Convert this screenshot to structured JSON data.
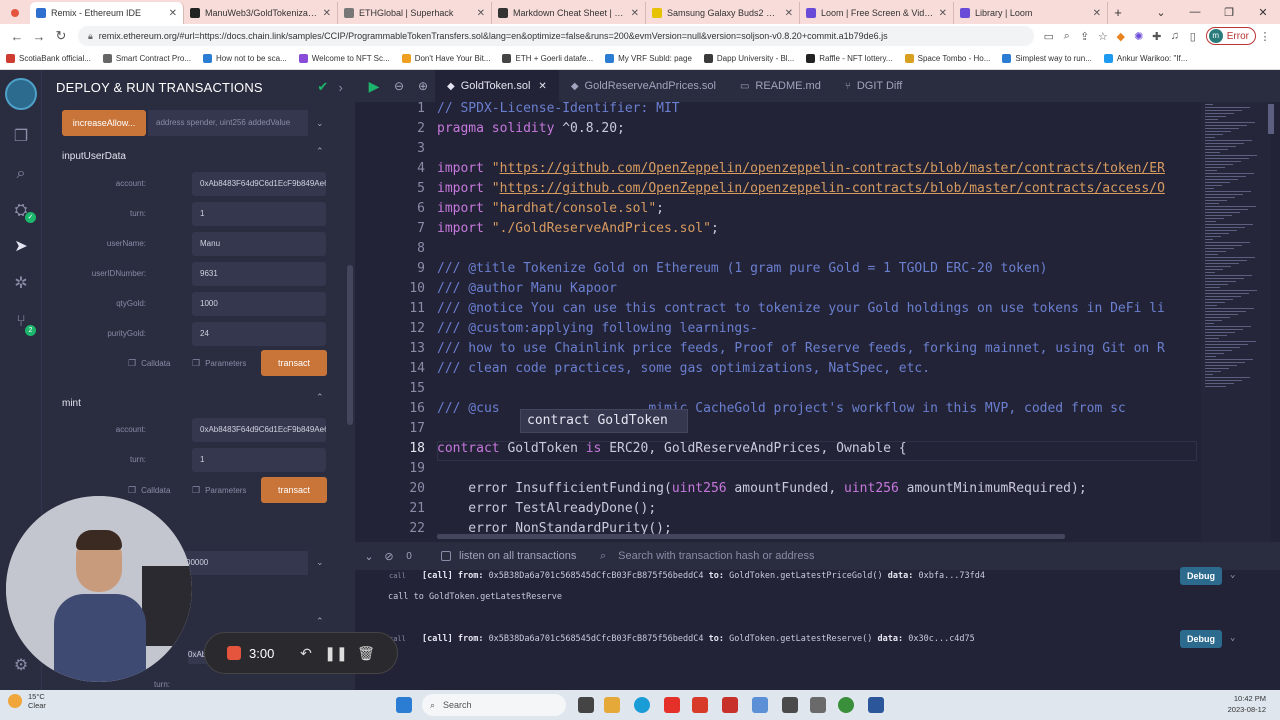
{
  "browser": {
    "tabs": [
      {
        "title": "Remix - Ethereum IDE",
        "color": "#2f6fd0",
        "active": true
      },
      {
        "title": "ManuWeb3/GoldTokenization",
        "color": "#222222"
      },
      {
        "title": "ETHGlobal | Superhack",
        "color": "#777777"
      },
      {
        "title": "Markdown Cheat Sheet | Mark",
        "color": "#333333"
      },
      {
        "title": "Samsung Galaxy Buds2 Pro In-",
        "color": "#e6c200"
      },
      {
        "title": "Loom | Free Screen & Video Re",
        "color": "#6a4bd8"
      },
      {
        "title": "Library | Loom",
        "color": "#6a4bd8"
      }
    ],
    "new_tab": "+",
    "url": "remix.ethereum.org/#url=https://docs.chain.link/samples/CCIP/ProgrammableTokenTransfers.sol&lang=en&optimize=false&runs=200&evmVersion=null&version=soljson-v0.8.20+commit.a1b79de6.js",
    "error_label": "Error",
    "profile_initial": "m",
    "bookmarks": [
      {
        "label": "ScotiaBank official...",
        "color": "#d03b2f"
      },
      {
        "label": "Smart Contract Pro...",
        "color": "#666666"
      },
      {
        "label": "How not to be sca...",
        "color": "#2b7cd3"
      },
      {
        "label": "Welcome to NFT Sc...",
        "color": "#8a4bd8"
      },
      {
        "label": "Don't Have Your Bit...",
        "color": "#f0a020"
      },
      {
        "label": "ETH + Goerli datafe...",
        "color": "#444444"
      },
      {
        "label": "My VRF Subld: page",
        "color": "#2b7cd3"
      },
      {
        "label": "Dapp University - Bl...",
        "color": "#3a3a3a"
      },
      {
        "label": "Raffle - NFT lottery...",
        "color": "#222222"
      },
      {
        "label": "Space Tombo - Ho...",
        "color": "#d8a020"
      },
      {
        "label": "Simplest way to run...",
        "color": "#2b7cd3"
      },
      {
        "label": "Ankur Warikoo: \"If...",
        "color": "#1d9bf0"
      }
    ]
  },
  "sidepanel": {
    "title": "DEPLOY & RUN TRANSACTIONS",
    "increase_allowance": {
      "button": "increaseAllow...",
      "placeholder": "address spender, uint256 addedValue"
    },
    "input_user_data": {
      "heading": "inputUserData",
      "fields": [
        {
          "label": "account:",
          "value": "0xAb8483F64d9C6d1EcF9b849Ae677dD"
        },
        {
          "label": "turn:",
          "value": "1"
        },
        {
          "label": "userName:",
          "value": "Manu"
        },
        {
          "label": "userIDNumber:",
          "value": "9631"
        },
        {
          "label": "qtyGold:",
          "value": "1000"
        },
        {
          "label": "purityGold:",
          "value": "24"
        }
      ]
    },
    "mint": {
      "heading": "mint",
      "fields": [
        {
          "label": "account:",
          "value": "0xAb8483F64d9C6d1EcF9b849Ae677dD"
        },
        {
          "label": "turn:",
          "value": "1"
        }
      ]
    },
    "calldata_label": "Calldata",
    "parameters_label": "Parameters",
    "transact_label": "transact",
    "partial_value": "00000",
    "partial_account": "0xAb8483F6",
    "partial_turn": "turn:"
  },
  "editor": {
    "tabs": [
      {
        "label": "GoldToken.sol",
        "active": true
      },
      {
        "label": "GoldReserveAndPrices.sol"
      },
      {
        "label": "README.md"
      },
      {
        "label": "DGIT Diff"
      }
    ],
    "current_line": 18,
    "hover_text": "contract GoldToken",
    "lines": [
      {
        "n": 1,
        "parts": [
          {
            "t": "// SPDX-License-Identifier: MIT",
            "c": "com"
          }
        ]
      },
      {
        "n": 2,
        "parts": [
          {
            "t": "pragma solidity",
            "c": "kw"
          },
          {
            "t": " ^0.8.20;",
            "c": ""
          }
        ]
      },
      {
        "n": 3,
        "parts": []
      },
      {
        "n": 4,
        "parts": [
          {
            "t": "import",
            "c": "kw"
          },
          {
            "t": " \"",
            "c": "str"
          },
          {
            "t": "https://github.com/OpenZeppelin/openzeppelin-contracts/blob/master/contracts/token/ER",
            "c": "url"
          }
        ]
      },
      {
        "n": 5,
        "parts": [
          {
            "t": "import",
            "c": "kw"
          },
          {
            "t": " \"",
            "c": "str"
          },
          {
            "t": "https://github.com/OpenZeppelin/openzeppelin-contracts/blob/master/contracts/access/O",
            "c": "url"
          }
        ]
      },
      {
        "n": 6,
        "parts": [
          {
            "t": "import",
            "c": "kw"
          },
          {
            "t": " \"hardhat/console.sol\"",
            "c": "str"
          },
          {
            "t": ";",
            "c": ""
          }
        ]
      },
      {
        "n": 7,
        "parts": [
          {
            "t": "import",
            "c": "kw"
          },
          {
            "t": " \"./GoldReserveAndPrices.sol\"",
            "c": "str"
          },
          {
            "t": ";",
            "c": ""
          }
        ]
      },
      {
        "n": 8,
        "parts": []
      },
      {
        "n": 9,
        "parts": [
          {
            "t": "/// @title Tokenize Gold on Ethereum (1 gram pure Gold = 1 TGOLD ERC-20 token)",
            "c": "com"
          }
        ]
      },
      {
        "n": 10,
        "parts": [
          {
            "t": "/// @author Manu Kapoor",
            "c": "com"
          }
        ]
      },
      {
        "n": 11,
        "parts": [
          {
            "t": "/// @notice You can use this contract to tokenize your Gold holdings on use tokens in DeFi li",
            "c": "com"
          }
        ]
      },
      {
        "n": 12,
        "parts": [
          {
            "t": "/// @custom:applying following learnings-",
            "c": "com"
          }
        ]
      },
      {
        "n": 13,
        "parts": [
          {
            "t": "/// how to use Chainlink price feeds, Proof of Reserve feeds, forking mainnet, using Git on R",
            "c": "com"
          }
        ]
      },
      {
        "n": 14,
        "parts": [
          {
            "t": "/// clean code practices, some gas optimizations, NatSpec, etc.",
            "c": "com"
          }
        ]
      },
      {
        "n": 15,
        "parts": []
      },
      {
        "n": 16,
        "parts": [
          {
            "t": "/// @cus                   mimic CacheGold project's workflow in this MVP, coded from sc",
            "c": "com"
          }
        ]
      },
      {
        "n": 17,
        "parts": []
      },
      {
        "n": 18,
        "parts": [
          {
            "t": "contract",
            "c": "kw"
          },
          {
            "t": " GoldToken ",
            "c": ""
          },
          {
            "t": "is",
            "c": "kw"
          },
          {
            "t": " ERC20, GoldReserveAndPrices, Ownable {",
            "c": ""
          }
        ]
      },
      {
        "n": 19,
        "parts": []
      },
      {
        "n": 20,
        "parts": [
          {
            "t": "    error InsufficientFunding(",
            "c": ""
          },
          {
            "t": "uint256",
            "c": "kw"
          },
          {
            "t": " amountFunded, ",
            "c": ""
          },
          {
            "t": "uint256",
            "c": "kw"
          },
          {
            "t": " amountMinimumRequired);",
            "c": ""
          }
        ]
      },
      {
        "n": 21,
        "parts": [
          {
            "t": "    error TestAlreadyDone();",
            "c": ""
          }
        ]
      },
      {
        "n": 22,
        "parts": [
          {
            "t": "    error NonStandardPurity();",
            "c": ""
          }
        ]
      }
    ]
  },
  "terminal": {
    "count": "0",
    "listen_label": "listen on all transactions",
    "search_placeholder": "Search with transaction hash or address",
    "call_tag": "call",
    "entries": [
      {
        "prefix": "[call]",
        "from_label": "from:",
        "from": "0x5B38Da6a701c568545dCfcB03FcB875f56beddC4",
        "to_label": "to:",
        "to": "GoldToken.getLatestPriceGold()",
        "data_label": "data:",
        "data": "0xbfa...73fd4"
      },
      {
        "prefix": "[call]",
        "from_label": "from:",
        "from": "0x5B38Da6a701c568545dCfcB03FcB875f56beddC4",
        "to_label": "to:",
        "to": "GoldToken.getLatestReserve()",
        "data_label": "data:",
        "data": "0x30c...c4d75"
      }
    ],
    "plain_line": "call to GoldToken.getLatestReserve",
    "debug_label": "Debug"
  },
  "recorder": {
    "time": "3:00"
  },
  "taskbar": {
    "temp": "15°C",
    "weather": "Clear",
    "search": "Search",
    "time": "10:42 PM",
    "date": "2023-08-12"
  }
}
